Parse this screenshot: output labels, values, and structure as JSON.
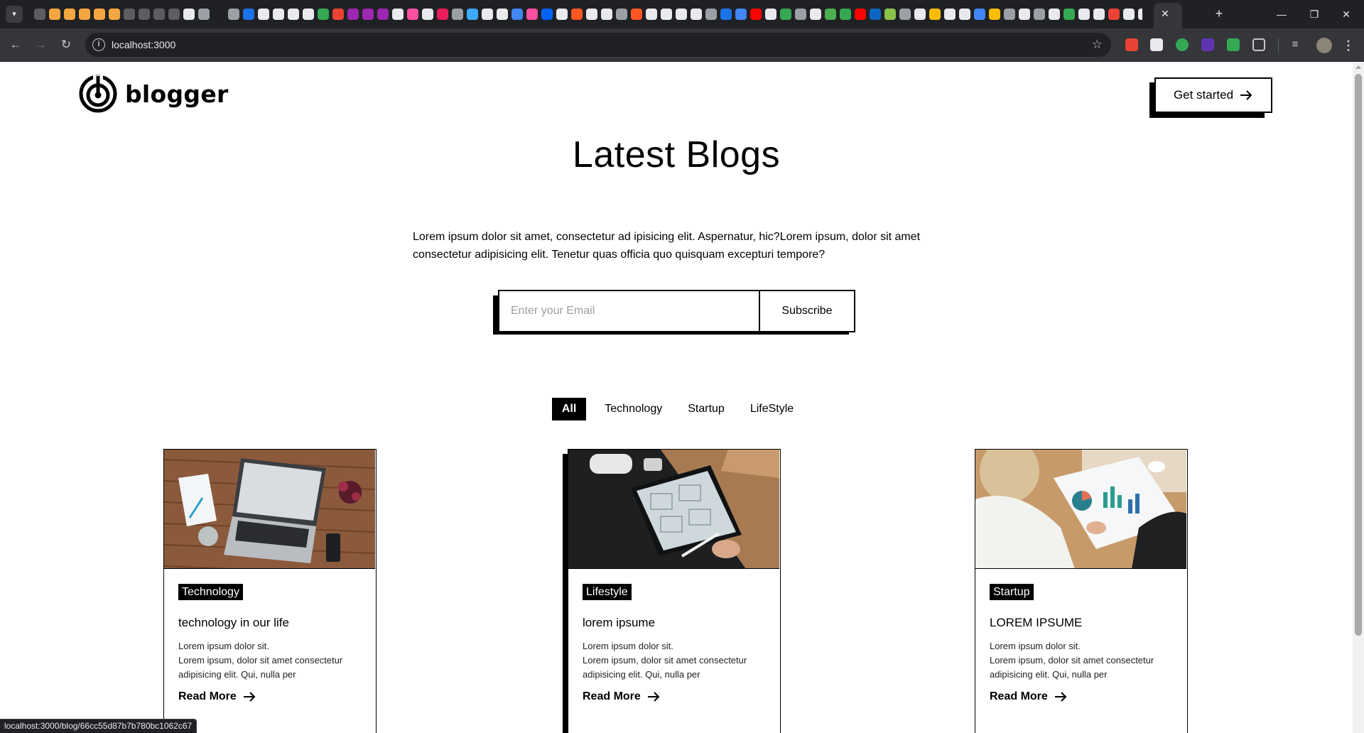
{
  "browser": {
    "url": "localhost:3000",
    "status_url": "localhost:3000/blog/66cc55d87b7b780bc1062c67",
    "tab_close_glyph": "✕",
    "new_tab_glyph": "+",
    "favicon_colors": [
      "#5b5d61",
      "#f4a640",
      "#f4a640",
      "#f4a640",
      "#f4a640",
      "#f4a640",
      "#5b5d61",
      "#5b5d61",
      "#5b5d61",
      "#5b5d61",
      "#e8eaed",
      "#9aa0a6",
      "#202124",
      "#9aa0a6",
      "#1a73e8",
      "#e8eaed",
      "#e8eaed",
      "#e8eaed",
      "#e8eaed",
      "#34a853",
      "#ea4335",
      "#9c27b0",
      "#9c27b0",
      "#9c27b0",
      "#e8eaed",
      "#ff4fa0",
      "#e8eaed",
      "#e81e5b",
      "#9aa0a6",
      "#3da9fc",
      "#e8eaed",
      "#e8eaed",
      "#4285f4",
      "#ff4fa0",
      "#0062ff",
      "#e8eaed",
      "#ff5722",
      "#e8eaed",
      "#e8eaed",
      "#9aa0a6",
      "#ff5722",
      "#e8eaed",
      "#e8eaed",
      "#e8eaed",
      "#e8eaed",
      "#9aa0a6",
      "#1a73e8",
      "#4285f4",
      "#ff0000",
      "#e8eaed",
      "#34a853",
      "#9aa0a6",
      "#e8eaed",
      "#4caf50",
      "#34a853",
      "#ff0000",
      "#0a66c2",
      "#8bc34a",
      "#9aa0a6",
      "#e8eaed",
      "#fbbc04",
      "#e8eaed",
      "#e8eaed",
      "#4285f4",
      "#fbbc04",
      "#9aa0a6",
      "#e8eaed",
      "#9aa0a6",
      "#e8eaed",
      "#34a853",
      "#e8eaed",
      "#e8eaed",
      "#ea4335",
      "#e8eaed",
      "#e8eaed",
      "#9aa0a6",
      "#4285f4"
    ],
    "extension_colors": [
      "#ea4335",
      "#e8eaed",
      "#34a853",
      "#5e35b1",
      "#34a853",
      "#c4c7c5"
    ]
  },
  "header": {
    "logo_text": "blogger",
    "cta_label": "Get started"
  },
  "hero": {
    "title": "Latest Blogs",
    "intro": "Lorem ipsum dolor sit amet, consectetur ad ipisicing elit. Aspernatur, hic?Lorem ipsum, dolor sit amet consectetur adipisicing elit. Tenetur quas officia quo quisquam excepturi tempore?",
    "email_placeholder": "Enter your Email",
    "subscribe_label": "Subscribe"
  },
  "filters": [
    "All",
    "Technology",
    "Startup",
    "LifeStyle"
  ],
  "active_filter": "All",
  "cards": [
    {
      "tag": "Technology",
      "title": "technology in our life",
      "text_1": "Lorem ipsum dolor sit.",
      "text_2": "Lorem ipsum, dolor sit amet consectetur adipisicing elit. Qui, nulla per",
      "read_more": "Read More"
    },
    {
      "tag": "Lifestyle",
      "title": "lorem ipsume",
      "text_1": "Lorem ipsum dolor sit.",
      "text_2": "Lorem ipsum, dolor sit amet consectetur adipisicing elit. Qui, nulla per",
      "read_more": "Read More"
    },
    {
      "tag": "Startup",
      "title": "LOREM IPSUME",
      "text_1": "Lorem ipsum dolor sit.",
      "text_2": "Lorem ipsum, dolor sit amet consectetur adipisicing elit. Qui, nulla per",
      "read_more": "Read More"
    }
  ]
}
